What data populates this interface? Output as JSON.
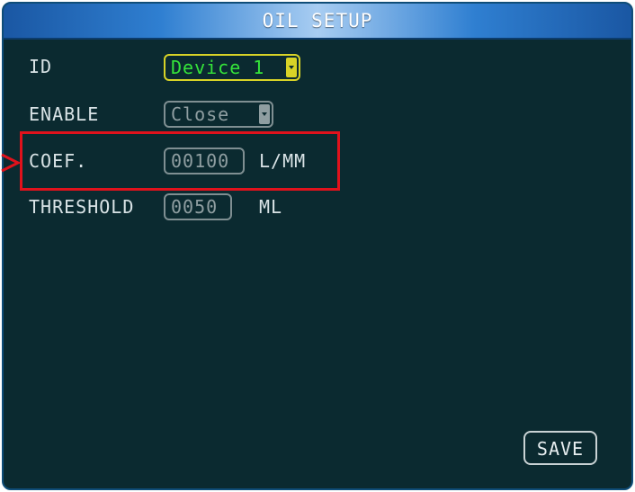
{
  "window": {
    "title": "OIL SETUP"
  },
  "form": {
    "id": {
      "label": "ID",
      "value": "Device 1"
    },
    "enable": {
      "label": "ENABLE",
      "value": "Close"
    },
    "coef": {
      "label": "COEF.",
      "value": "00100",
      "unit": "L/MM"
    },
    "threshold": {
      "label": "THRESHOLD",
      "value": "0050",
      "unit": "ML"
    }
  },
  "buttons": {
    "save_label": "SAVE"
  },
  "colors": {
    "background": "#0b2a30",
    "title_bar": "#2f7fd1",
    "focus_border": "#d8d327",
    "focus_text": "#35e43a",
    "highlight": "#e0121c"
  },
  "icons": {
    "dropdown": "chevron-down-icon",
    "pointer": "arrow-right-icon"
  }
}
